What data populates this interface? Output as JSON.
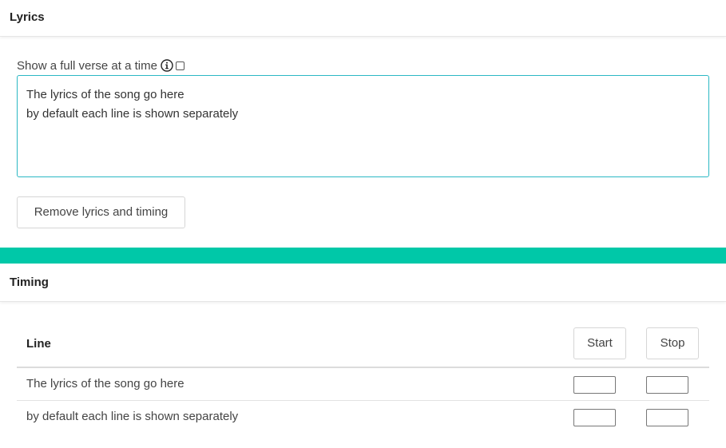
{
  "lyrics_section": {
    "title": "Lyrics",
    "verse_option_label": "Show a full verse at a time",
    "verse_option_checked": false,
    "lyrics_text": "The lyrics of the song go here\nby default each line is shown separately",
    "remove_button_label": "Remove lyrics and timing"
  },
  "timing_section": {
    "title": "Timing",
    "column_line": "Line",
    "start_button_label": "Start",
    "stop_button_label": "Stop",
    "rows": [
      {
        "text": "The lyrics of the song go here",
        "start": "",
        "stop": ""
      },
      {
        "text": "by default each line is shown separately",
        "start": "",
        "stop": ""
      }
    ]
  },
  "colors": {
    "accent_bar": "#00c8a8",
    "textarea_focus_border": "#2bb8c4"
  },
  "icons": {
    "info": "info-icon"
  }
}
